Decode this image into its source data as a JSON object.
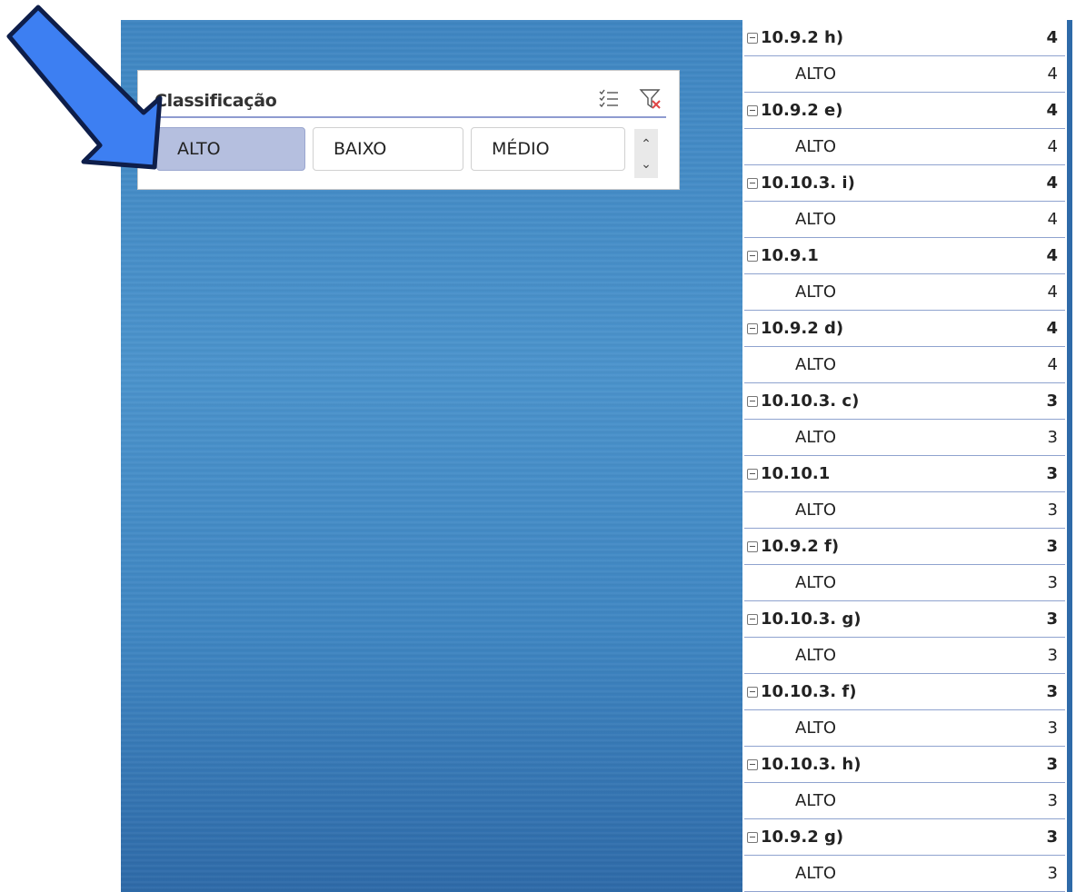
{
  "slicer": {
    "title": "Classificação",
    "items": [
      "ALTO",
      "BAIXO",
      "MÉDIO"
    ],
    "selected": "ALTO",
    "icons": [
      "multi-select-icon",
      "clear-filter-icon",
      "scroll-up-icon",
      "scroll-down-icon"
    ]
  },
  "pivot": {
    "rows": [
      {
        "label": "10.9.2 h)",
        "value": "4",
        "type": "group"
      },
      {
        "label": "ALTO",
        "value": "4",
        "type": "child"
      },
      {
        "label": "10.9.2 e)",
        "value": "4",
        "type": "group"
      },
      {
        "label": "ALTO",
        "value": "4",
        "type": "child"
      },
      {
        "label": "10.10.3. i)",
        "value": "4",
        "type": "group"
      },
      {
        "label": "ALTO",
        "value": "4",
        "type": "child"
      },
      {
        "label": "10.9.1",
        "value": "4",
        "type": "group"
      },
      {
        "label": "ALTO",
        "value": "4",
        "type": "child"
      },
      {
        "label": "10.9.2 d)",
        "value": "4",
        "type": "group"
      },
      {
        "label": "ALTO",
        "value": "4",
        "type": "child"
      },
      {
        "label": "10.10.3. c)",
        "value": "3",
        "type": "group"
      },
      {
        "label": "ALTO",
        "value": "3",
        "type": "child"
      },
      {
        "label": "10.10.1",
        "value": "3",
        "type": "group"
      },
      {
        "label": "ALTO",
        "value": "3",
        "type": "child"
      },
      {
        "label": "10.9.2 f)",
        "value": "3",
        "type": "group"
      },
      {
        "label": "ALTO",
        "value": "3",
        "type": "child"
      },
      {
        "label": "10.10.3. g)",
        "value": "3",
        "type": "group"
      },
      {
        "label": "ALTO",
        "value": "3",
        "type": "child"
      },
      {
        "label": "10.10.3. f)",
        "value": "3",
        "type": "group"
      },
      {
        "label": "ALTO",
        "value": "3",
        "type": "child"
      },
      {
        "label": "10.10.3. h)",
        "value": "3",
        "type": "group"
      },
      {
        "label": "ALTO",
        "value": "3",
        "type": "child"
      },
      {
        "label": "10.9.2 g)",
        "value": "3",
        "type": "group"
      },
      {
        "label": "ALTO",
        "value": "3",
        "type": "child"
      }
    ]
  },
  "colors": {
    "background": "#4b93cc",
    "slicer_selected": "#b5bfdf",
    "arrow_fill": "#3d7ff2",
    "row_border": "#8fa3cf"
  }
}
